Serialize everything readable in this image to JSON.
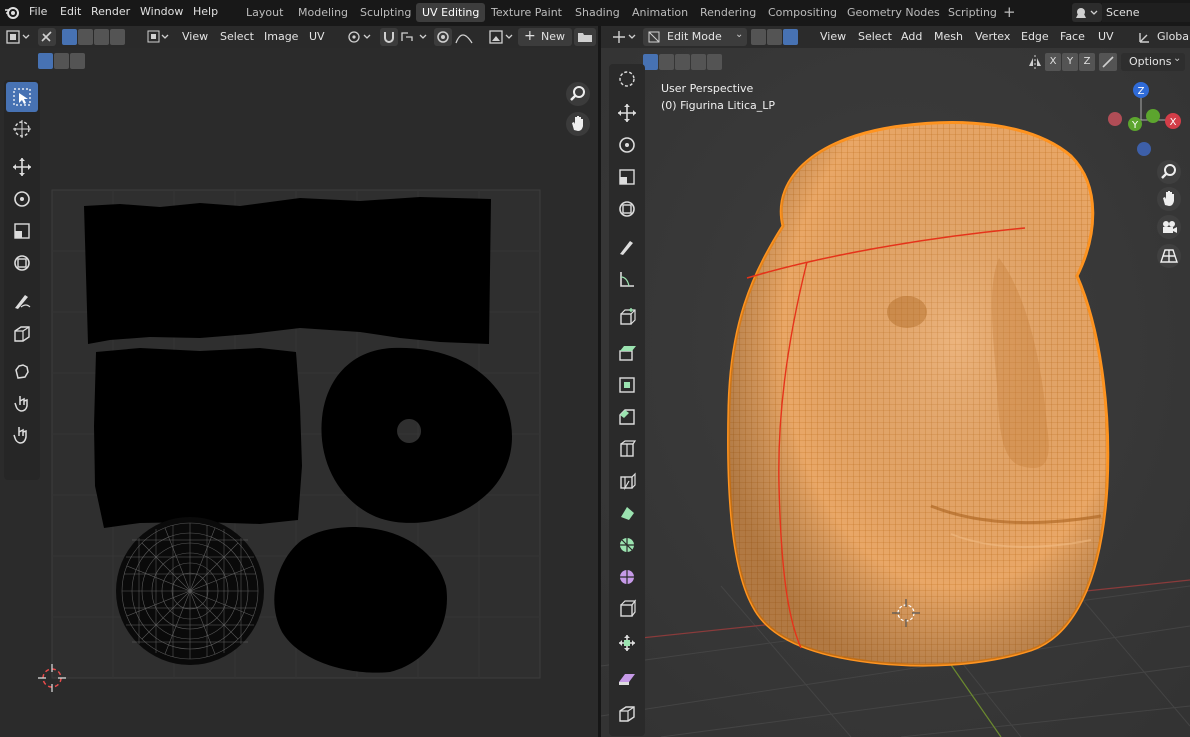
{
  "menu": {
    "file": "File",
    "edit": "Edit",
    "render": "Render",
    "window": "Window",
    "help": "Help"
  },
  "workspaces": [
    "Layout",
    "Modeling",
    "Sculpting",
    "UV Editing",
    "Texture Paint",
    "Shading",
    "Animation",
    "Rendering",
    "Compositing",
    "Geometry Nodes",
    "Scripting"
  ],
  "active_workspace": "UV Editing",
  "scene_label": "Scene",
  "uv_header": {
    "view": "View",
    "select": "Select",
    "image": "Image",
    "uv": "UV",
    "new_label": "New"
  },
  "view3d_header": {
    "mode": "Edit Mode",
    "view": "View",
    "select": "Select",
    "add": "Add",
    "mesh": "Mesh",
    "vertex": "Vertex",
    "edge": "Edge",
    "face": "Face",
    "uv": "UV",
    "orientation": "Global"
  },
  "view3d_subheader": {
    "x": "X",
    "y": "Y",
    "z": "Z",
    "options": "Options"
  },
  "viewport_overlay": {
    "perspective": "User Perspective",
    "object": "(0) Figurina Litica_LP"
  },
  "gizmo": {
    "z": "Z",
    "y": "Y",
    "x": "X"
  },
  "colors": {
    "accent": "#4772b3",
    "mesh_fill": "#e8a15d",
    "wire": "#c86a1a",
    "seam": "#e03a1c",
    "uv_island": "#000000"
  }
}
